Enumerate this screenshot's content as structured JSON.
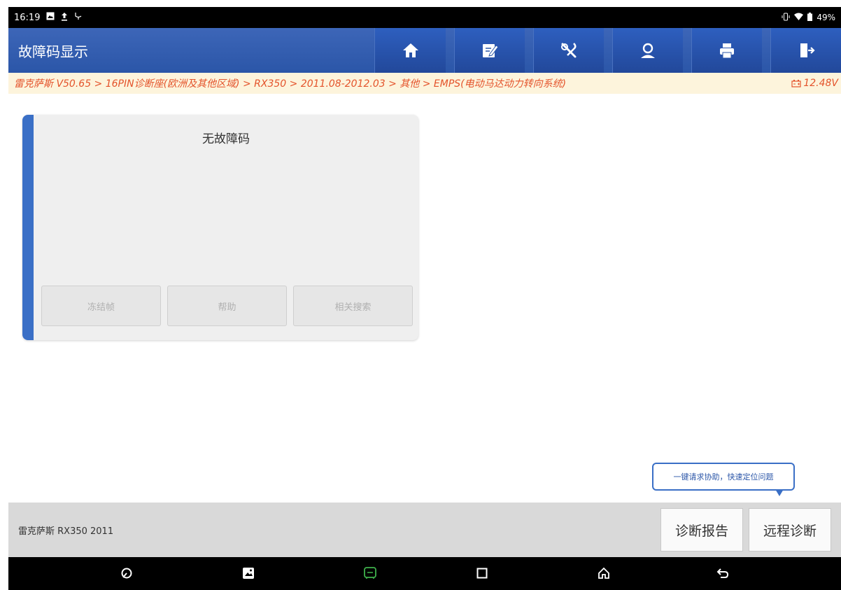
{
  "status_bar": {
    "time": "16:19",
    "battery_percent": "49%",
    "icons": [
      "gallery-icon",
      "upload-icon",
      "diag-icon",
      "vibrate-icon",
      "wifi-icon",
      "battery-icon"
    ]
  },
  "header": {
    "title": "故障码显示",
    "toolbar_icons": [
      "home-icon",
      "edit-icon",
      "tools-icon",
      "support-icon",
      "print-icon",
      "exit-icon"
    ]
  },
  "breadcrumb": {
    "path": "雷克萨斯 V50.65 > 16PIN诊断座(欧洲及其他区域) > RX350 > 2011.08-2012.03 > 其他 > EMPS(电动马达动力转向系统)",
    "voltage": "12.48V"
  },
  "dtc_card": {
    "message": "无故障码",
    "buttons": [
      "冻结帧",
      "帮助",
      "相关搜索"
    ]
  },
  "tooltip": {
    "text": "一键请求协助，快速定位问题"
  },
  "bottom_bar": {
    "vehicle": "雷克萨斯 RX350 2011",
    "report_button": "诊断报告",
    "remote_button": "远程诊断"
  },
  "nav_bar": {
    "icons": [
      "browser-icon",
      "gallery-icon",
      "diag-app-icon",
      "recents-icon",
      "home-icon",
      "back-icon"
    ]
  },
  "colors": {
    "header_blue": "#2b56a8",
    "accent_blue": "#3a6fc6",
    "breadcrumb_text": "#e4532b",
    "breadcrumb_bg": "#fdf4dc"
  }
}
